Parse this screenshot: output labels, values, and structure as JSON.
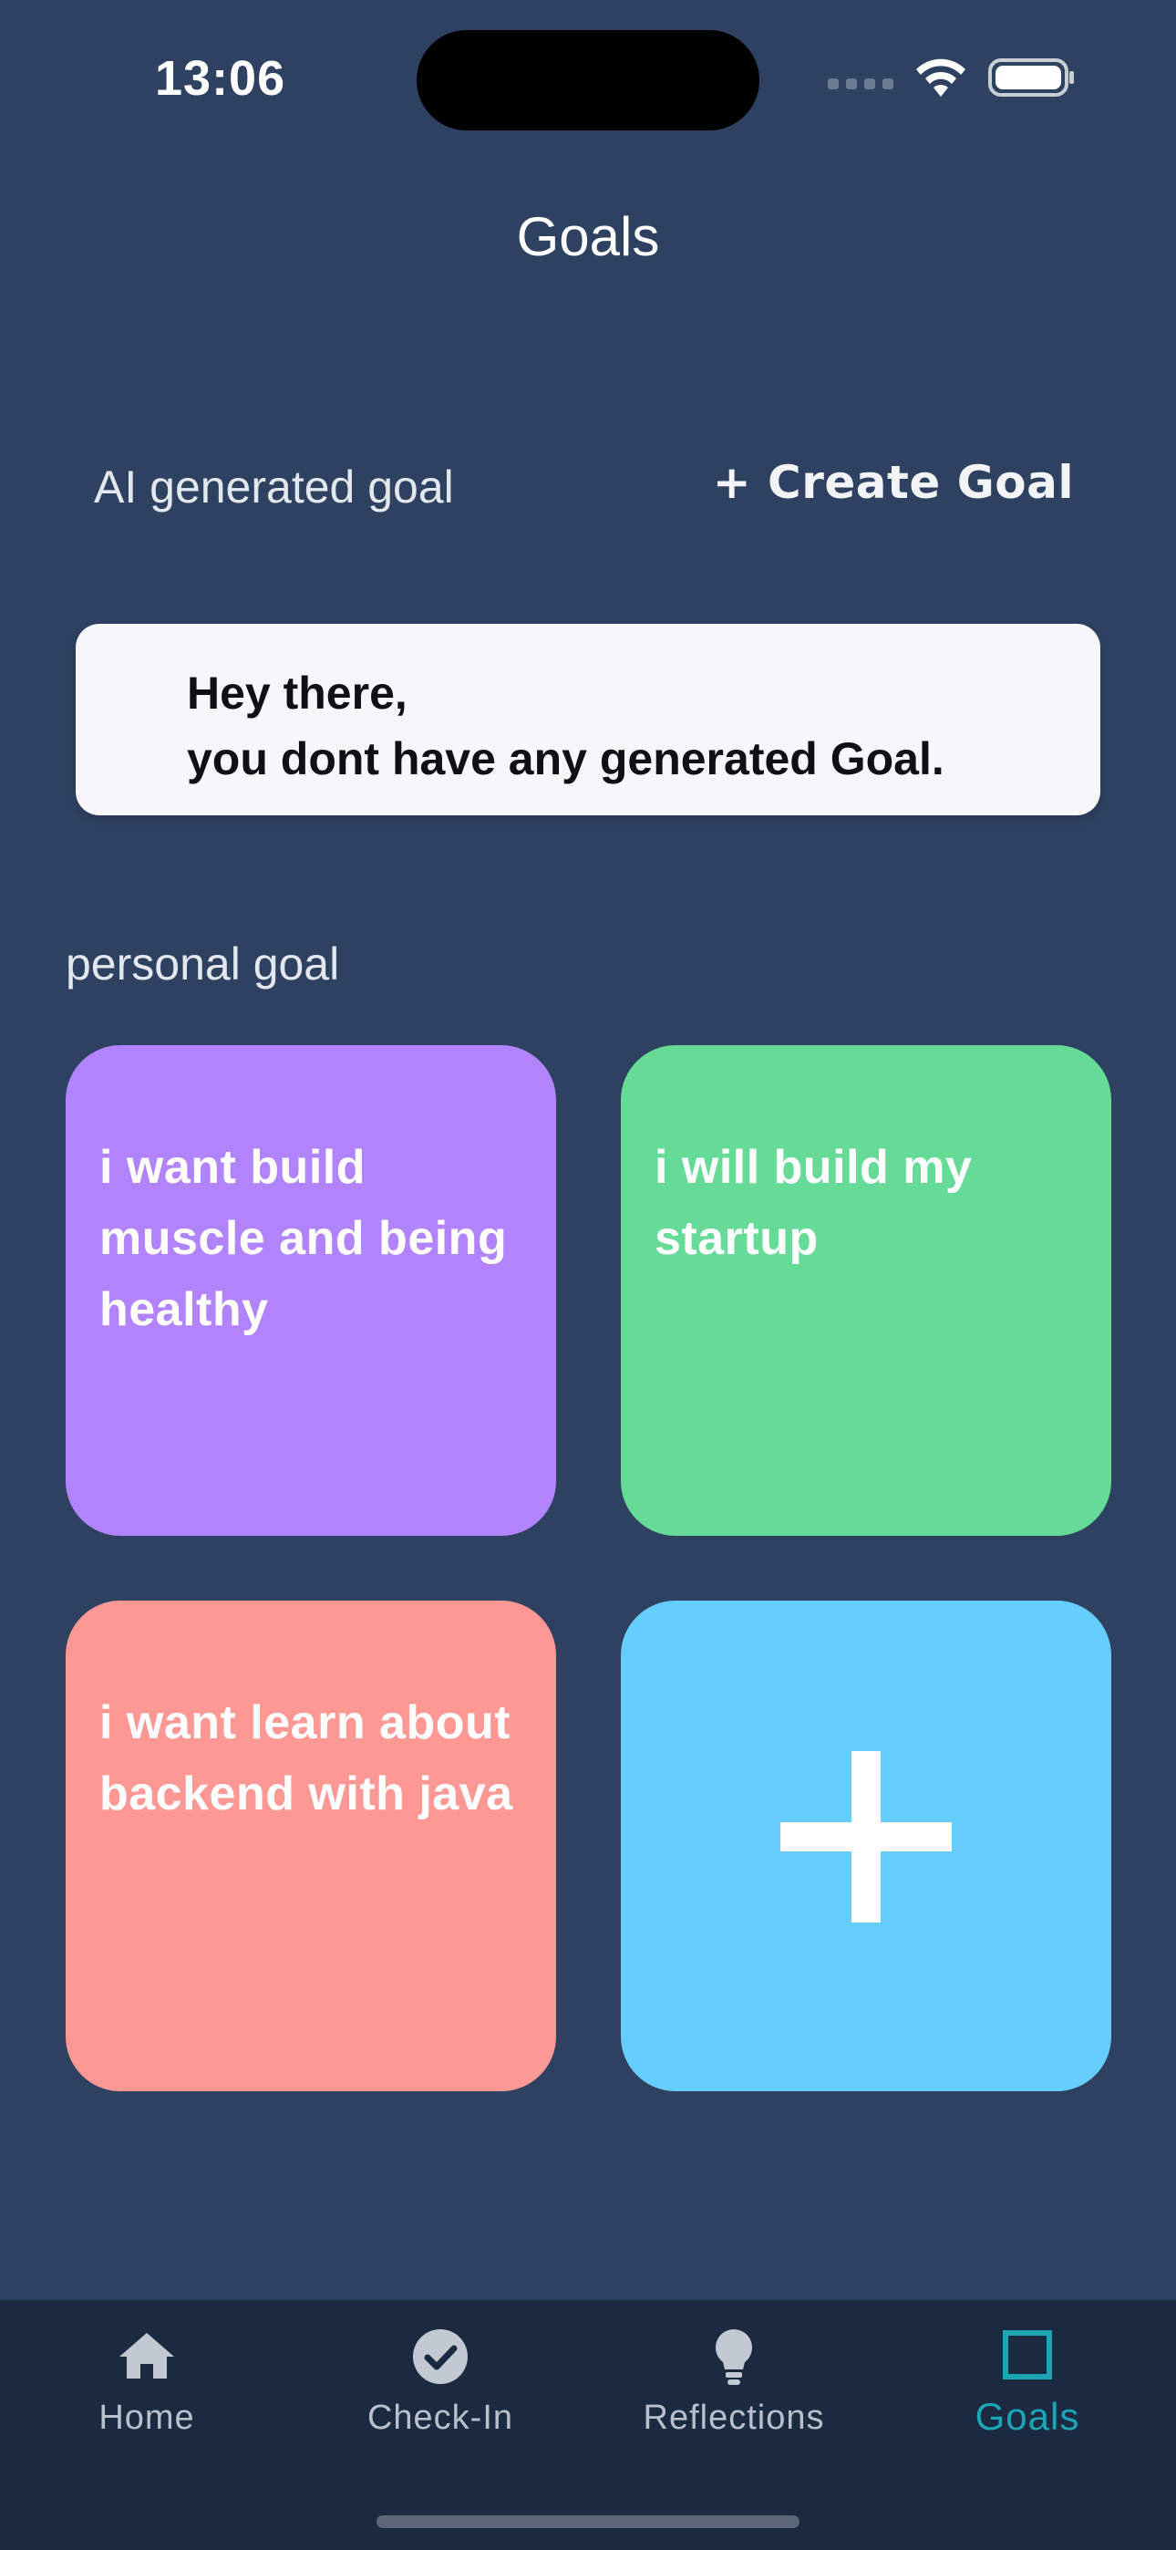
{
  "status_bar": {
    "time": "13:06"
  },
  "header": {
    "title": "Goals"
  },
  "ai_section": {
    "label": "AI generated goal",
    "create_button": "+ Create Goal",
    "card": {
      "line1": "Hey there,",
      "line2": "you dont have any generated Goal."
    }
  },
  "personal_section": {
    "label": "personal goal",
    "goals": [
      {
        "text": "i want build muscle and being healthy",
        "color": "#b183fd"
      },
      {
        "text": "i will build my startup",
        "color": "#66db97"
      },
      {
        "text": "i want learn about backend with java",
        "color": "#fe9894"
      }
    ],
    "add_tile": {
      "icon": "plus-icon",
      "color": "#66ceff"
    }
  },
  "tab_bar": {
    "items": [
      {
        "label": "Home",
        "icon": "home-icon"
      },
      {
        "label": "Check-In",
        "icon": "check-circle-icon"
      },
      {
        "label": "Reflections",
        "icon": "lightbulb-icon"
      },
      {
        "label": "Goals",
        "icon": "square-icon",
        "active": true
      }
    ],
    "active_color": "#1aa6b5",
    "inactive_color": "#b9c0cc"
  }
}
